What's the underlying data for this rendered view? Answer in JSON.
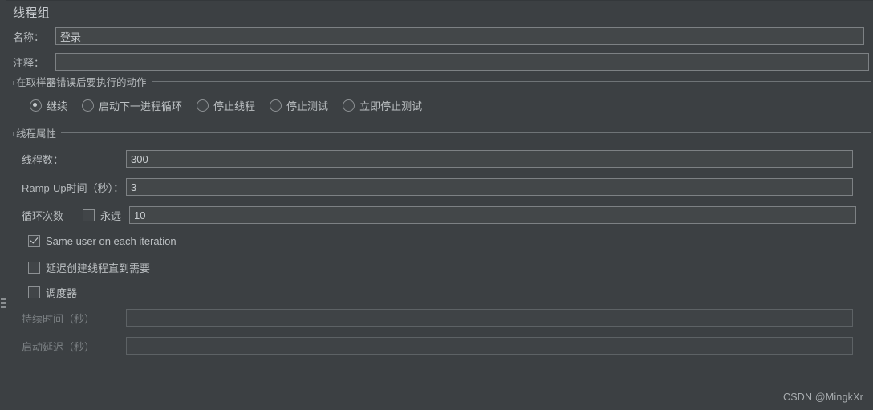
{
  "window": {
    "title": "线程组"
  },
  "fields": {
    "name_label": "名称：",
    "name_value": "登录",
    "comment_label": "注释：",
    "comment_value": ""
  },
  "error_action_group": {
    "title": "在取样器错误后要执行的动作",
    "options": [
      {
        "label": "继续",
        "selected": true
      },
      {
        "label": "启动下一进程循环",
        "selected": false
      },
      {
        "label": "停止线程",
        "selected": false
      },
      {
        "label": "停止测试",
        "selected": false
      },
      {
        "label": "立即停止测试",
        "selected": false
      }
    ]
  },
  "thread_properties": {
    "title": "线程属性",
    "num_threads_label": "线程数：",
    "num_threads_value": "300",
    "ramp_up_label": "Ramp-Up时间（秒）：",
    "ramp_up_value": "3",
    "loop_count_label": "循环次数",
    "forever_label": "永远",
    "forever_checked": false,
    "loop_count_value": "10",
    "same_user_label": "Same user on each iteration",
    "same_user_checked": true,
    "delayed_start_label": "延迟创建线程直到需要",
    "delayed_start_checked": false,
    "scheduler_label": "调度器",
    "scheduler_checked": false,
    "duration_label": "持续时间（秒）",
    "duration_value": "",
    "startup_delay_label": "启动延迟（秒）",
    "startup_delay_value": ""
  },
  "watermark": {
    "text": "CSDN @MingkXr"
  },
  "colors": {
    "background": "#3c4043",
    "field_background": "#434749",
    "field_border": "#7d8184",
    "text": "#bdc1c4",
    "text_dim": "#7c8184",
    "separator": "#6f7477"
  }
}
